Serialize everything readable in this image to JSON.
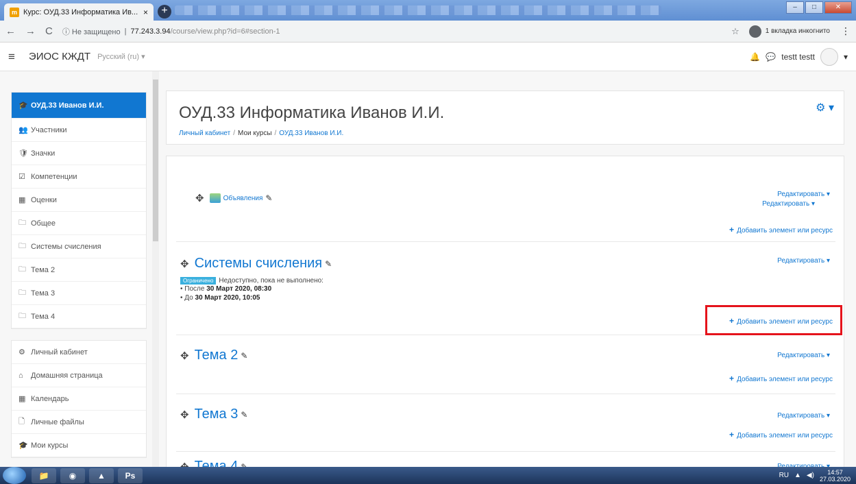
{
  "browser": {
    "tab_title": "Курс: ОУД.33 Информатика Ив...",
    "tab_favicon": "m",
    "tab_close": "×",
    "new_tab": "+",
    "back": "←",
    "forward": "→",
    "reload": "C",
    "security_label": "ⓘ Не защищено",
    "url_host": "77.243.3.94",
    "url_path": "/course/view.php?id=6#section-1",
    "bookmark_star": "☆",
    "incognito_label": "1 вкладка инкогнито",
    "menu_dots": "⋮"
  },
  "navbar": {
    "menu_icon": "≡",
    "brand": "ЭИОС КЖДТ",
    "language": "Русский (ru) ▾",
    "bell_icon": "🔔",
    "chat_icon": "💬",
    "user_name": "testt testt",
    "user_caret": "▾"
  },
  "sidebar": {
    "course_items": [
      {
        "icon": "🎓",
        "label": "ОУД.33 Иванов И.И."
      },
      {
        "icon": "👥",
        "label": "Участники"
      },
      {
        "icon": "🛡",
        "label": "Значки"
      },
      {
        "icon": "☑",
        "label": "Компетенции"
      },
      {
        "icon": "▦",
        "label": "Оценки"
      },
      {
        "icon": "🗀",
        "label": "Общее"
      },
      {
        "icon": "🗀",
        "label": "Системы счисления"
      },
      {
        "icon": "🗀",
        "label": "Тема 2"
      },
      {
        "icon": "🗀",
        "label": "Тема 3"
      },
      {
        "icon": "🗀",
        "label": "Тема 4"
      }
    ],
    "site_items": [
      {
        "icon": "⚙",
        "label": "Личный кабинет"
      },
      {
        "icon": "⌂",
        "label": "Домашняя страница"
      },
      {
        "icon": "▦",
        "label": "Календарь"
      },
      {
        "icon": "🗋",
        "label": "Личные файлы"
      },
      {
        "icon": "🎓",
        "label": "Мои курсы"
      }
    ]
  },
  "header": {
    "title": "ОУД.33 Информатика Иванов И.И.",
    "breadcrumb": [
      "Личный кабинет",
      "Мои курсы",
      "ОУД.33 Иванов И.И."
    ],
    "breadcrumb_sep": "/",
    "gear_icon": "⚙ ▾"
  },
  "common": {
    "edit_label": "Редактировать ▾",
    "add_label": "Добавить элемент или ресурс",
    "plus": "+",
    "move": "✥",
    "pencil": "✎"
  },
  "sections": {
    "general": {
      "activity_name": "Объявления",
      "activity_edit": "Редактировать ▾",
      "edit": "Редактировать ▾"
    },
    "s1": {
      "title": "Системы счисления",
      "restriction_badge": "Ограничено",
      "restriction_text": "Недоступно, пока не выполнено:",
      "cond1_prefix": "• После ",
      "cond1_value": "30 Март 2020, 08:30",
      "cond2_prefix": "• До ",
      "cond2_value": "30 Март 2020, 10:05"
    },
    "s2": {
      "title": "Тема 2"
    },
    "s3": {
      "title": "Тема 3"
    },
    "s4": {
      "title": "Тема 4"
    }
  },
  "taskbar": {
    "apps": [
      "📁",
      "◉",
      "▲",
      "Ps"
    ],
    "lang": "RU",
    "time": "14:57",
    "date": "27.03.2020"
  },
  "colors": {
    "accent": "#1177d1",
    "highlight": "#e5131b"
  }
}
